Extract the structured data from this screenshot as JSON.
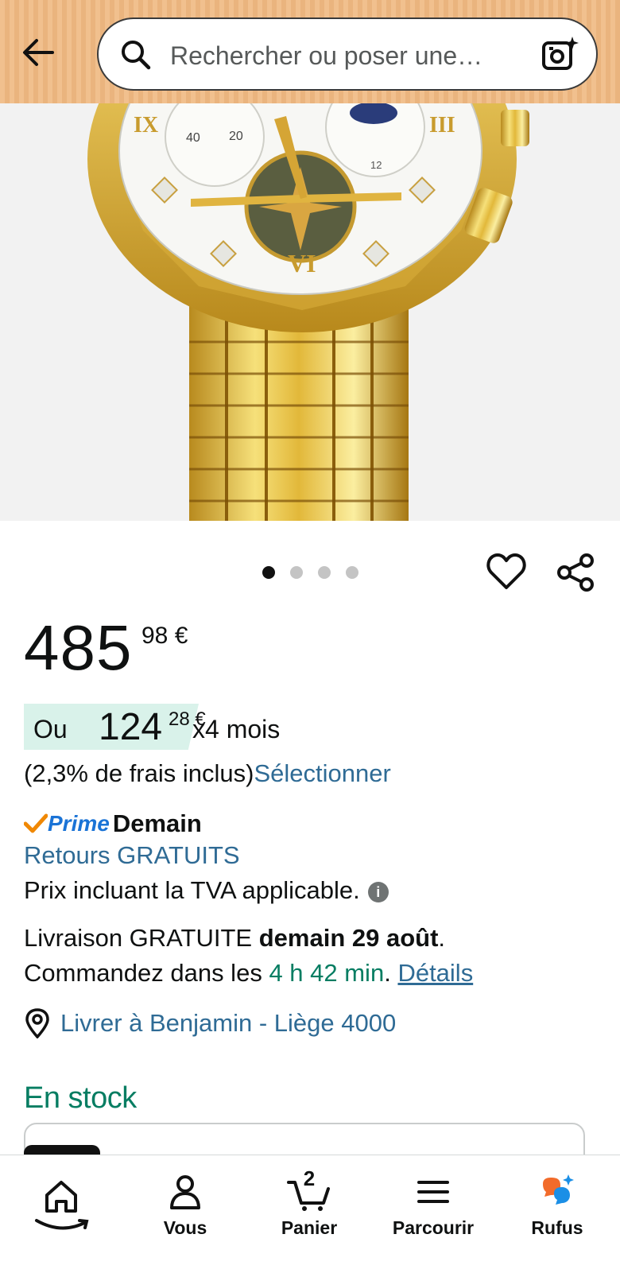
{
  "search": {
    "placeholder": "Rechercher ou poser une…"
  },
  "carousel": {
    "count": 4,
    "active_index": 0
  },
  "price": {
    "whole": "485",
    "fraction_currency": "98 €"
  },
  "installment": {
    "prefix": "Ou",
    "amount_whole": "124",
    "amount_fraction": "28 €",
    "suffix": "x4 mois"
  },
  "fees": {
    "text": "(2,3% de frais inclus)",
    "link": "Sélectionner"
  },
  "prime": {
    "label": "Prime",
    "delivery": "Demain"
  },
  "returns": "Retours GRATUITS",
  "tva": "Prix incluant la TVA applicable.",
  "delivery": {
    "prefix": "Livraison GRATUITE ",
    "date": "demain 29 août",
    "period": ".",
    "order_prefix": "Commandez dans les ",
    "countdown": "4 h 42 min",
    "order_suffix": ". ",
    "details_link": "Détails"
  },
  "address": "Livrer à Benjamin - Liège 4000",
  "stock": "En stock",
  "nav": {
    "home": "",
    "you": "Vous",
    "cart": "Panier",
    "cart_count": "2",
    "browse": "Parcourir",
    "rufus": "Rufus"
  },
  "colors": {
    "link": "#2f6b95",
    "green": "#067d62",
    "prime": "#1a73d6",
    "prime_check": "#f08804"
  }
}
